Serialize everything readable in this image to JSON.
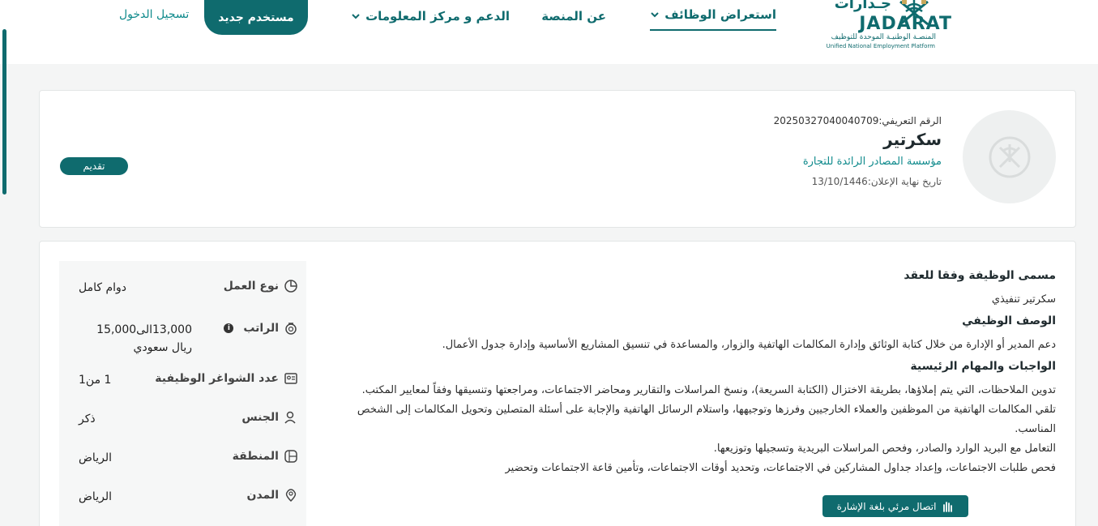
{
  "brand": {
    "name": "JADARAT",
    "arabic_top": "جـدارات",
    "tagline_ar": "المنصـة الوطنيـة الموحدة للتوظيف",
    "tagline_en": "Unified National Employment Platform",
    "accent": "#0f6b6e"
  },
  "nav": {
    "jobs": "استعراض الوظائف",
    "about": "عن المنصة",
    "support": "الدعم و مركز المعلومات",
    "new_user": "مستخدم جديد",
    "login": "تسجيل الدخول"
  },
  "job": {
    "ref_label": "الرقم التعريفي:",
    "ref_value": "20250327040040709",
    "title": "سكرتير",
    "company": "مؤسسة المصادر الرائدة للتجارة",
    "deadline_label": "تاريخ نهاية الإعلان:",
    "deadline_value": "13/10/1446",
    "apply": "تقديم"
  },
  "description": {
    "contract_title_heading": "مسمى الوظيفة وفقا للعقد",
    "contract_title": "سكرتير تنفيذي",
    "summary_heading": "الوصف الوظيفي",
    "summary": "دعم المدير أو الإدارة من خلال كتابة الوثائق وإدارة المكالمات الهاتفية والزوار، والمساعدة في تنسيق المشاريع الأساسية وإدارة جدول الأعمال.",
    "duties_heading": "الواجبات والمهام الرئيسية",
    "duties": [
      "تدوين الملاحظات، التي يتم إملاؤها، بطريقة الاختزال (الكتابة السريعة)، ونسخ المراسلات والتقارير ومحاضر الاجتماعات، ومراجعتها وتنسيقها وفقاً لمعايير المكتب.",
      "تلقي المكالمات الهاتفية من الموظفين والعملاء الخارجيين وفرزها وتوجيهها، واستلام الرسائل الهاتفية والإجابة على أسئلة المتصلين وتحويل المكالمات إلى الشخص المناسب.",
      "التعامل مع البريد الوارد والصادر، وفحص المراسلات البريدية وتسجيلها وتوزيعها.",
      "فحص طلبات الاجتماعات، وإعداد جداول المشاركين في الاجتماعات، وتحديد أوقات الاجتماعات، وتأمين قاعة الاجتماعات وتحضير"
    ]
  },
  "details": {
    "work_type_label": "نوع العمل",
    "work_type": "دوام كامل",
    "salary_label": "الراتب",
    "salary": "13,000الى15,000 ريال سعودي",
    "vacancies_label": "عدد الشواغر الوظيفية",
    "vacancies": "1 من1",
    "gender_label": "الجنس",
    "gender": "ذكر",
    "region_label": "المنطقة",
    "region": "الرياض",
    "city_label": "المدن",
    "city": "الرياض"
  },
  "accessibility": {
    "sign_language": "اتصال مرئي بلغة الإشارة"
  }
}
